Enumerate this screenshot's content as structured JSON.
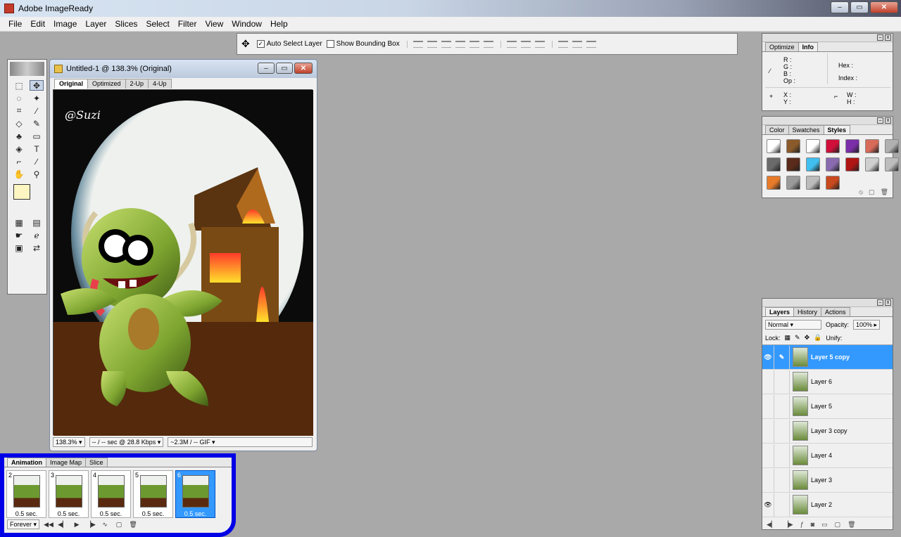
{
  "app": {
    "title": "Adobe ImageReady"
  },
  "window_controls": {
    "minimize": "–",
    "maximize": "▭",
    "close": "✕"
  },
  "menu": [
    "File",
    "Edit",
    "Image",
    "Layer",
    "Slices",
    "Select",
    "Filter",
    "View",
    "Window",
    "Help"
  ],
  "options_bar": {
    "auto_select_layer": "Auto Select Layer",
    "auto_select_checked": true,
    "show_bounding_box": "Show Bounding Box",
    "show_bounding_checked": false
  },
  "document": {
    "title": "Untitled-1 @ 138.3% (Original)",
    "tabs": [
      "Original",
      "Optimized",
      "2-Up",
      "4-Up"
    ],
    "active_tab": "Original",
    "signature": "@Suzi",
    "status": {
      "zoom": "138.3%",
      "download": "-- / -- sec @ 28.8 Kbps",
      "size": "~2.3M / -- GIF"
    }
  },
  "info_panel": {
    "tabs": [
      "Optimize",
      "Info"
    ],
    "active_tab": "Info",
    "labels_rgb": [
      "R :",
      "G :",
      "B :",
      "Op :"
    ],
    "labels_hex": [
      "Hex :",
      "Index :"
    ],
    "labels_xy": [
      "X :",
      "Y :"
    ],
    "labels_wh": [
      "W :",
      "H :"
    ]
  },
  "styles_panel": {
    "tabs": [
      "Color",
      "Swatches",
      "Styles"
    ],
    "active_tab": "Styles",
    "swatches": [
      "#ffffff",
      "#8b5a2b",
      "#ffffff",
      "#d0103a",
      "#7a2ea8",
      "#d86a5a",
      "#b0b0b0",
      "#6a6a6a",
      "#5a2a1a",
      "#40c0f0",
      "#8a6bb0",
      "#b01515",
      "#cfcfcf",
      "#bdbdbd",
      "#e87b2a",
      "#9a9a9a",
      "#bcbcbc",
      "#c84a1e"
    ]
  },
  "layers_panel": {
    "tabs": [
      "Layers",
      "History",
      "Actions"
    ],
    "active_tab": "Layers",
    "blend_mode": "Normal",
    "opacity_label": "Opacity:",
    "opacity": "100%",
    "lock_label": "Lock:",
    "unify_label": "Unify:",
    "layers": [
      {
        "name": "Layer 5 copy",
        "visible": true,
        "selected": true
      },
      {
        "name": "Layer 6",
        "visible": false,
        "selected": false
      },
      {
        "name": "Layer 5",
        "visible": false,
        "selected": false
      },
      {
        "name": "Layer 3 copy",
        "visible": false,
        "selected": false
      },
      {
        "name": "Layer 4",
        "visible": false,
        "selected": false
      },
      {
        "name": "Layer 3",
        "visible": false,
        "selected": false
      },
      {
        "name": "Layer 2",
        "visible": true,
        "selected": false
      }
    ]
  },
  "animation_panel": {
    "tabs": [
      "Animation",
      "Image Map",
      "Slice"
    ],
    "active_tab": "Animation",
    "frames": [
      {
        "num": "2",
        "delay": "0.5 sec."
      },
      {
        "num": "3",
        "delay": "0.5 sec."
      },
      {
        "num": "4",
        "delay": "0.5 sec."
      },
      {
        "num": "5",
        "delay": "0.5 sec."
      },
      {
        "num": "6",
        "delay": "0.5 sec.",
        "selected": true
      }
    ],
    "loop": "Forever"
  }
}
